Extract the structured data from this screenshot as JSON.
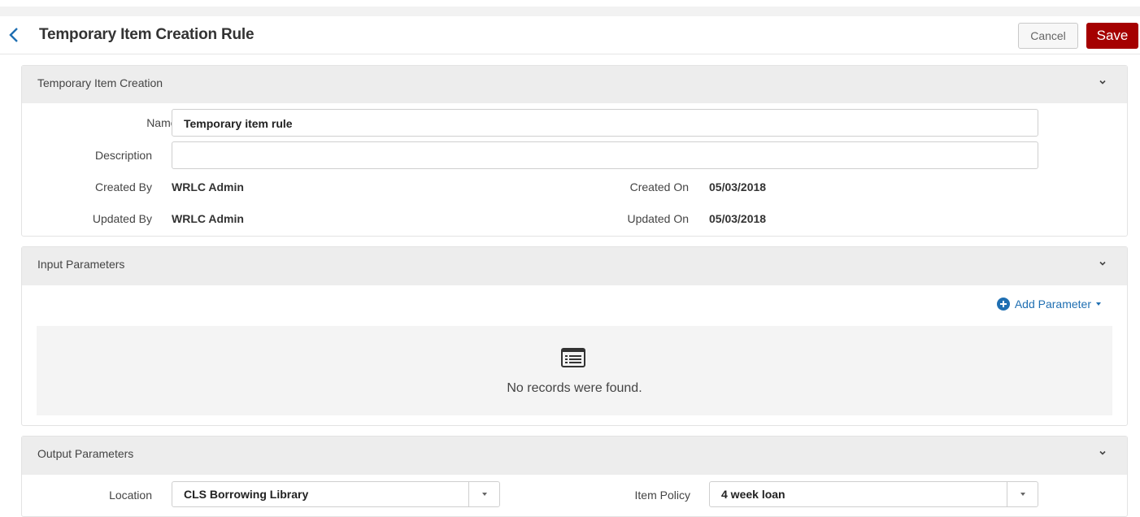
{
  "header": {
    "title": "Temporary Item Creation Rule",
    "cancel_label": "Cancel",
    "save_label": "Save"
  },
  "creation_panel": {
    "title": "Temporary Item Creation",
    "name_label": "Name",
    "required_mark": "*",
    "name_value": "Temporary item rule",
    "description_label": "Description",
    "description_value": "",
    "created_by_label": "Created By",
    "created_by_value": "WRLC Admin",
    "created_on_label": "Created On",
    "created_on_value": "05/03/2018",
    "updated_by_label": "Updated By",
    "updated_by_value": "WRLC Admin",
    "updated_on_label": "Updated On",
    "updated_on_value": "05/03/2018"
  },
  "input_panel": {
    "title": "Input Parameters",
    "add_parameter_label": "Add Parameter",
    "empty_text": "No records were found."
  },
  "output_panel": {
    "title": "Output Parameters",
    "location_label": "Location",
    "location_value": "CLS Borrowing Library",
    "item_policy_label": "Item Policy",
    "item_policy_value": "4 week loan"
  },
  "colors": {
    "accent": "#1f6fb2",
    "save": "#a50000",
    "panel_header": "#ededed"
  }
}
